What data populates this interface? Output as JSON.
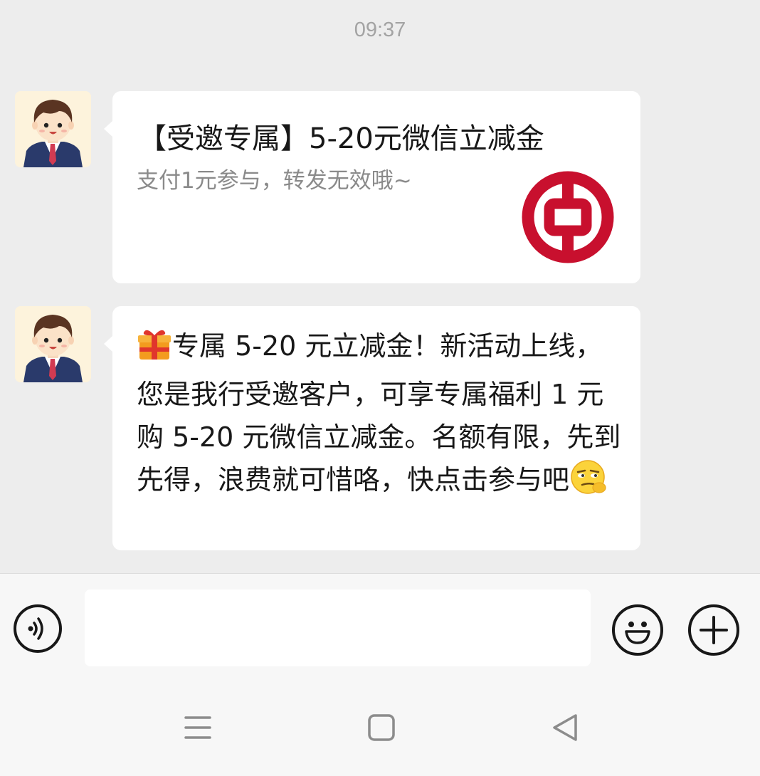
{
  "status": {
    "time": "09:37"
  },
  "messages": [
    {
      "type": "card",
      "sender": "bank-assistant-avatar",
      "title": "【受邀专属】5-20元微信立减金",
      "description": "支付1元参与，转发无效哦~",
      "logo_icon": "bank-of-china-logo-icon"
    },
    {
      "type": "text",
      "sender": "bank-assistant-avatar",
      "lead_emoji": "gift-icon",
      "text": "专属 5-20 元立减金！新活动上线，您是我行受邀客户，可享专属福利 1 元购 5-20 元微信立减金。名额有限，先到先得，浪费就可惜咯，快点击参与吧",
      "trail_emoji": "smirk-face-icon"
    }
  ],
  "input_bar": {
    "voice_icon": "voice-icon",
    "input_value": "",
    "emoji_icon": "emoji-face-icon",
    "add_icon": "plus-icon"
  },
  "nav": {
    "menu_icon": "menu-icon",
    "home_icon": "home-square-icon",
    "back_icon": "back-triangle-icon"
  },
  "colors": {
    "chat_background": "#ededed",
    "bubble_background": "#ffffff",
    "logo_red": "#c8102e",
    "text_primary": "#181818",
    "text_secondary": "#8a8a8a"
  }
}
